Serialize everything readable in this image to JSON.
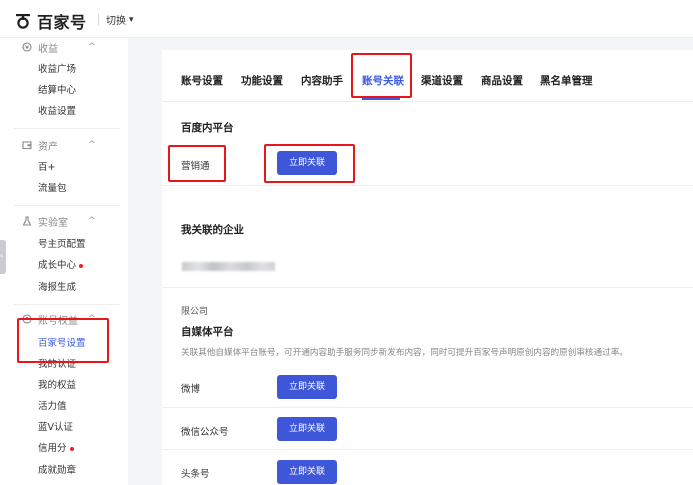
{
  "header": {
    "brand": "百家号",
    "switch_label": "切换"
  },
  "sidebar": {
    "sections": [
      {
        "title": "收益",
        "icon": "coin-icon",
        "items": [
          {
            "label": "收益广场"
          },
          {
            "label": "结算中心"
          },
          {
            "label": "收益设置"
          }
        ]
      },
      {
        "title": "资产",
        "icon": "wallet-icon",
        "items": [
          {
            "label": "百+"
          },
          {
            "label": "流量包"
          }
        ]
      },
      {
        "title": "实验室",
        "icon": "lab-icon",
        "items": [
          {
            "label": "号主页配置"
          },
          {
            "label": "成长中心",
            "dot": true
          },
          {
            "label": "海报生成"
          }
        ]
      },
      {
        "title": "账号权益",
        "icon": "account-icon",
        "items": [
          {
            "label": "百家号设置",
            "active": true
          },
          {
            "label": "我的认证"
          },
          {
            "label": "我的权益"
          },
          {
            "label": "活力值"
          },
          {
            "label": "蓝V认证"
          },
          {
            "label": "信用分",
            "dot": true
          },
          {
            "label": "成就勋章"
          }
        ]
      }
    ]
  },
  "tabs": [
    {
      "label": "账号设置"
    },
    {
      "label": "功能设置"
    },
    {
      "label": "内容助手"
    },
    {
      "label": "账号关联",
      "active": true
    },
    {
      "label": "渠道设置"
    },
    {
      "label": "商品设置"
    },
    {
      "label": "黑名单管理"
    }
  ],
  "baidu_platform": {
    "title": "百度内平台",
    "items": [
      {
        "name": "营销通",
        "button": "立即关联"
      }
    ]
  },
  "enterprise": {
    "title": "我关联的企业",
    "company_suffix": "限公司"
  },
  "media_platform": {
    "title": "自媒体平台",
    "description": "关联其他自媒体平台账号，可开通内容助手服务同步新发布内容，同时可提升百家号声明原创内容的原创审核通过率。",
    "items": [
      {
        "name": "微博",
        "button": "立即关联"
      },
      {
        "name": "微信公众号",
        "button": "立即关联"
      },
      {
        "name": "头条号",
        "button": "立即关联"
      }
    ]
  },
  "colors": {
    "accent": "#3a59e6",
    "button": "#3e56d8",
    "highlight": "#e8151b",
    "dot": "#e3262a"
  }
}
